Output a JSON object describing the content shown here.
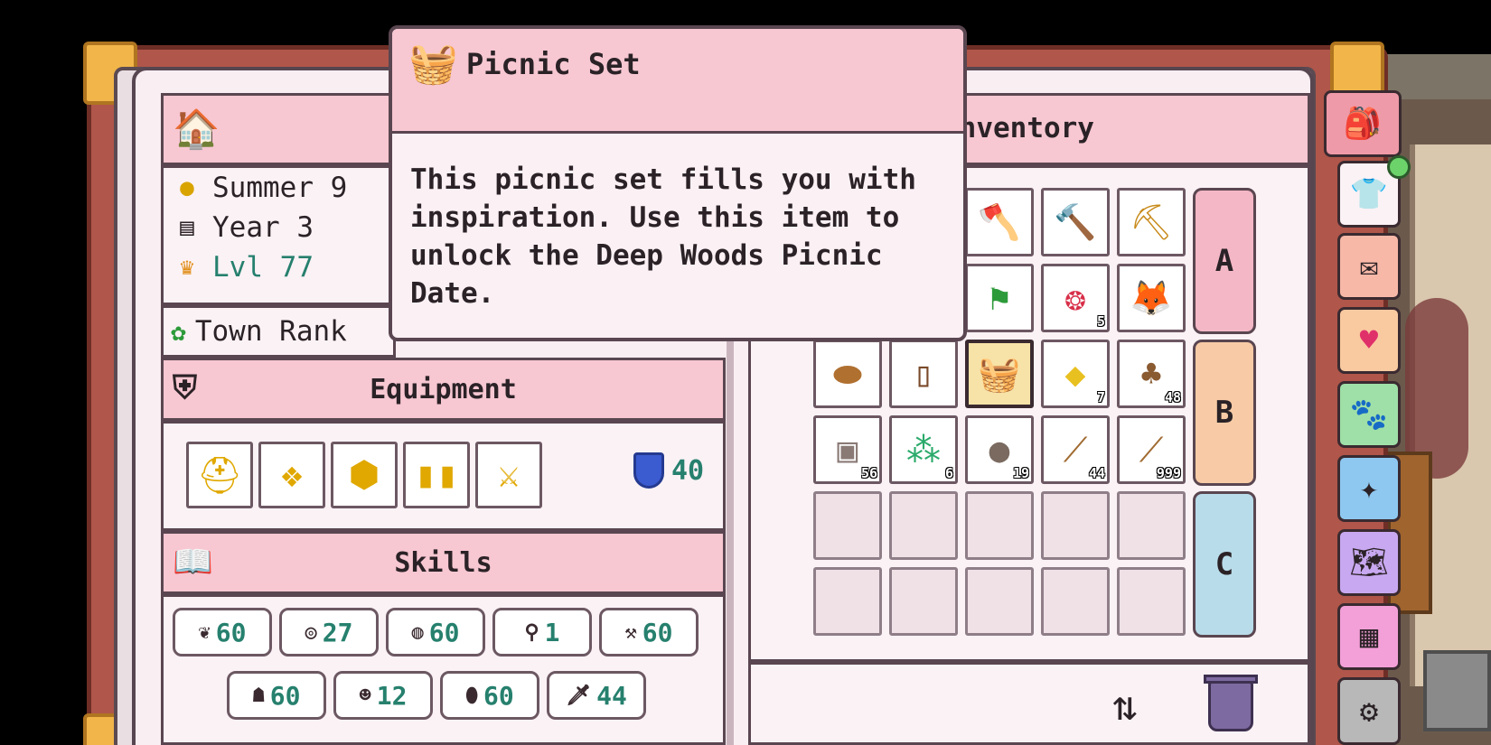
{
  "status": {
    "date": "Summer 9",
    "year": "Year 3",
    "level": "Lvl 77",
    "town_rank": "Town Rank"
  },
  "equipment": {
    "title": "Equipment",
    "slots": [
      "gold-helmet-icon",
      "gold-chest-icon",
      "gold-armor-icon",
      "gold-boots-icon",
      "gold-sword-icon"
    ],
    "defense": "40"
  },
  "skills": {
    "title": "Skills",
    "row1": [
      {
        "icon": "farming-icon",
        "value": "60"
      },
      {
        "icon": "fishing-icon",
        "value": "27"
      },
      {
        "icon": "bug-catching-icon",
        "value": "60"
      },
      {
        "icon": "cooking-icon",
        "value": "1"
      },
      {
        "icon": "mining-icon",
        "value": "60"
      }
    ],
    "row2": [
      {
        "icon": "critter-icon",
        "value": "60"
      },
      {
        "icon": "pet-icon",
        "value": "12"
      },
      {
        "icon": "magic-icon",
        "value": "60"
      },
      {
        "icon": "combat-icon",
        "value": "44"
      }
    ]
  },
  "inventory": {
    "title": "Inventory",
    "rows": [
      "A",
      "B",
      "C"
    ],
    "items": [
      {
        "icon": "axe-icon",
        "count": ""
      },
      {
        "icon": "hammer-icon",
        "count": ""
      },
      {
        "icon": "pickaxe-icon",
        "count": ""
      },
      {
        "icon": "shovel-icon",
        "count": ""
      },
      {
        "icon": "seed-bag-icon",
        "count": "5"
      },
      {
        "icon": "pet-fox-icon",
        "count": ""
      },
      {
        "icon": "bread-icon",
        "count": ""
      },
      {
        "icon": "door-icon",
        "count": ""
      },
      {
        "icon": "picnic-set-icon",
        "count": ""
      },
      {
        "icon": "gold-ore-icon",
        "count": "7"
      },
      {
        "icon": "wood-icon",
        "count": "48"
      },
      {
        "icon": "stone-block-icon",
        "count": "56"
      },
      {
        "icon": "gems-icon",
        "count": "6"
      },
      {
        "icon": "rock-icon",
        "count": "19"
      },
      {
        "icon": "stick-icon",
        "count": "44"
      },
      {
        "icon": "branch-icon",
        "count": "999"
      }
    ]
  },
  "tooltip": {
    "title": "Picnic Set",
    "description": "This picnic set fills you with inspiration. Use this item to unlock the Deep Woods Picnic Date."
  },
  "side_tabs": [
    "backpack-icon",
    "shirt-icon",
    "mail-icon",
    "heart-icon",
    "pets-icon",
    "sparkle-icon",
    "map-icon",
    "calendar-icon",
    "settings-icon"
  ],
  "colors": {
    "accent_pink": "#f7c7d2",
    "stat_green": "#26806e",
    "row_a": "#f4b7c6",
    "row_b": "#f8cba6",
    "row_c": "#b9dcea"
  }
}
